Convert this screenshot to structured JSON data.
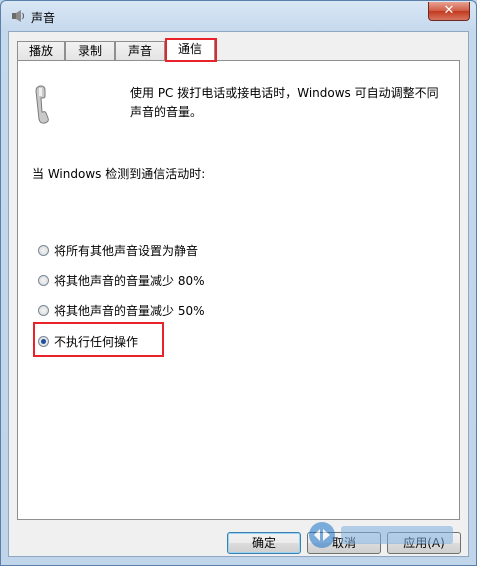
{
  "window": {
    "title": "声音",
    "close_symbol": "✕"
  },
  "tabs": [
    {
      "label": "播放"
    },
    {
      "label": "录制"
    },
    {
      "label": "声音"
    },
    {
      "label": "通信"
    }
  ],
  "communications": {
    "description": "使用 PC 拨打电话或接电话时，Windows 可自动调整不同声音的音量。",
    "prompt": "当 Windows 检测到通信活动时:",
    "options": [
      {
        "label": "将所有其他声音设置为静音",
        "selected": false
      },
      {
        "label": "将其他声音的音量减少 80%",
        "selected": false
      },
      {
        "label": "将其他声音的音量减少 50%",
        "selected": false
      },
      {
        "label": "不执行任何操作",
        "selected": true
      }
    ]
  },
  "buttons": {
    "ok": "确定",
    "cancel": "取消",
    "apply": "应用(A)"
  },
  "colors": {
    "highlight": "#e8232a",
    "title_bar": "#c5d8ec",
    "close": "#c2391f"
  },
  "icons": {
    "title": "speaker-icon",
    "panel": "phone-icon",
    "watermark": "logo-watermark"
  }
}
